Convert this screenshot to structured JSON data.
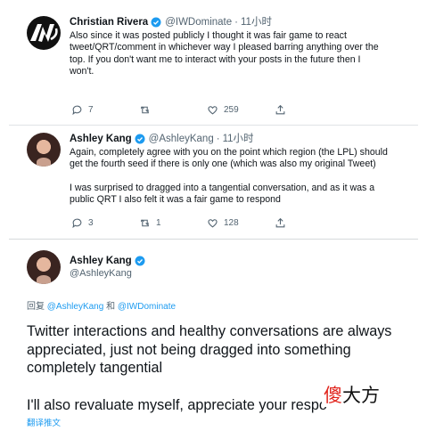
{
  "tweets": [
    {
      "name": "Christian Rivera",
      "handle": "@IWDominate",
      "separator": "·",
      "time": "11小时",
      "avatar_icon": "iwd-logo-avatar",
      "body_lines": [
        "Also since it was posted publicly I thought it was fair game to react",
        "tweet/QRT/comment in whichever way I pleased barring anything over the",
        "top.  If you don't want me to interact with your posts in the future then I",
        "won't."
      ],
      "actions": {
        "replies": "7",
        "retweets": "",
        "likes": "259"
      }
    },
    {
      "name": "Ashley Kang",
      "handle": "@AshleyKang",
      "separator": "·",
      "time": "11小时",
      "avatar_icon": "profile-photo-avatar",
      "para1_lines": [
        "Again, completely agree with you on the point which region (the LPL) should",
        "get the fourth seed if there is only one (which was also my original Tweet)"
      ],
      "para2_lines": [
        "I was surprised to dragged into a tangential conversation, and as it was a",
        "public QRT I also felt it was a fair game to respond"
      ],
      "actions": {
        "replies": "3",
        "retweets": "1",
        "likes": "128"
      }
    }
  ],
  "main_tweet": {
    "name": "Ashley Kang",
    "handle": "@AshleyKang",
    "reply_prefix": "回复",
    "reply_to_1": "@AshleyKang",
    "reply_joiner": "和",
    "reply_to_2": "@IWDominate",
    "para1": "Twitter interactions and healthy conversations are always appreciated, just not being dragged into something completely tangential",
    "para2": "I'll also revaluate myself, appreciate your respo",
    "translate_label": "翻译推文"
  },
  "overlay": {
    "red_char": "傻",
    "black_chars": "大方"
  },
  "colors": {
    "link": "#1d9bf0",
    "verified": "#1d9bf0",
    "muted": "#536471",
    "overlay_red": "#e0231b"
  }
}
